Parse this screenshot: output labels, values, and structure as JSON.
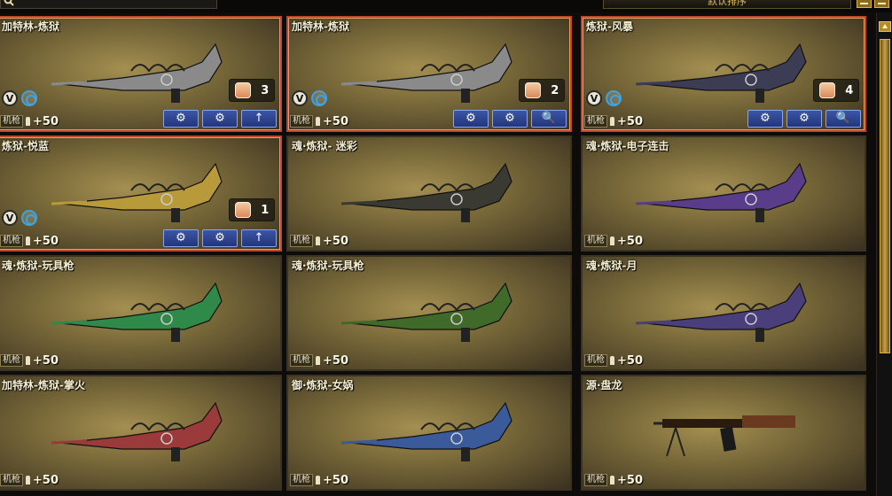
{
  "header": {
    "sort_label": "默认排序"
  },
  "icons": {
    "search": "magnifier-icon",
    "v_badge": "v-badge-icon",
    "target": "crosshair-icon",
    "slot": "backpack-icon",
    "upgrade": "wrench-gear-icon",
    "settings": "gear-icon",
    "up": "arrow-up-icon",
    "inspect": "magnifier-icon"
  },
  "colors": {
    "equipped_border": "#c0452a",
    "action_button": "#2f4690",
    "card_gold": "#a48f51"
  },
  "cards": [
    {
      "name": "加特林-炼狱",
      "category": "机枪",
      "ammo": "+50",
      "slot": "3",
      "buttons": [
        "⚙",
        "⚙",
        "↑"
      ],
      "weapon_color": "#8a8a8a"
    },
    {
      "name": "加特林-炼狱",
      "category": "机枪",
      "ammo": "+50",
      "slot": "2",
      "buttons": [
        "⚙",
        "⚙",
        "🔍"
      ],
      "weapon_color": "#8a8a8a"
    },
    {
      "name": "炼狱-风暴",
      "category": "机枪",
      "ammo": "+50",
      "slot": "4",
      "buttons": [
        "⚙",
        "⚙",
        "🔍"
      ],
      "weapon_color": "#3c3c55"
    },
    {
      "name": "炼狱-悦蓝",
      "category": "机枪",
      "ammo": "+50",
      "slot": "1",
      "buttons": [
        "⚙",
        "⚙",
        "↑"
      ],
      "weapon_color": "#b89a3a"
    },
    {
      "name": "魂·炼狱- 迷彩",
      "category": "机枪",
      "ammo": "+50",
      "weapon_color": "#3a3a32"
    },
    {
      "name": "魂·炼狱-电子连击",
      "category": "机枪",
      "ammo": "+50",
      "weapon_color": "#5a3d8a"
    },
    {
      "name": "魂·炼狱-玩具枪",
      "category": "机枪",
      "ammo": "+50",
      "weapon_color": "#2f8a4a"
    },
    {
      "name": "魂·炼狱-玩具枪",
      "category": "机枪",
      "ammo": "+50",
      "weapon_color": "#3f6a2a"
    },
    {
      "name": "魂·炼狱-月",
      "category": "机枪",
      "ammo": "+50",
      "weapon_color": "#4a3f7a"
    },
    {
      "name": "加特林-炼狱-掌火",
      "category": "机枪",
      "ammo": "+50",
      "weapon_color": "#9a3a3a"
    },
    {
      "name": "御·炼狱-女娲",
      "category": "机枪",
      "ammo": "+50",
      "weapon_color": "#3a5a9a"
    },
    {
      "name": "源·盘龙",
      "category": "机枪",
      "ammo": "+50",
      "weapon_color": "#4a3020"
    }
  ]
}
